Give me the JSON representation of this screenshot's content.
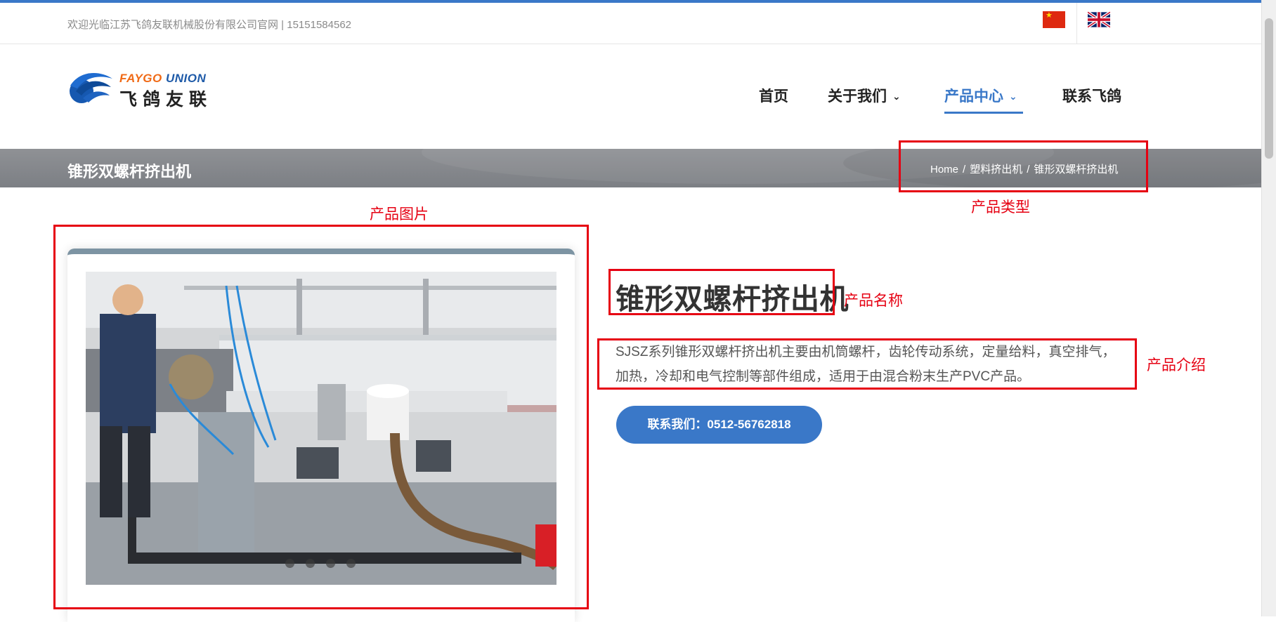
{
  "topbar": {
    "welcome_text": "欢迎光临江苏飞鸽友联机械股份有限公司官网 | 15151584562"
  },
  "logo": {
    "text_en_1": "FAYGO",
    "text_en_2": "UNION",
    "text_cn": "飞鸽友联"
  },
  "nav": {
    "items": [
      {
        "label": "首页"
      },
      {
        "label": "关于我们",
        "dropdown_icon": "chevron-down-icon"
      },
      {
        "label": "产品中心",
        "dropdown_icon": "chevron-down-icon",
        "active": true
      },
      {
        "label": "联系飞鸽"
      }
    ],
    "active_color": "#3a78c8"
  },
  "banner": {
    "title": "锥形双螺杆挤出机",
    "breadcrumb": [
      "Home",
      "塑料挤出机",
      "锥形双螺杆挤出机"
    ]
  },
  "product": {
    "name": "锥形双螺杆挤出机",
    "description": "SJSZ系列锥形双螺杆挤出机主要由机筒螺杆，齿轮传动系统，定量给料，真空排气，加热，冷却和电气控制等部件组成，适用于由混合粉末生产PVC产品。",
    "contact_button": "联系我们：0512-56762818"
  },
  "annotations": {
    "product_image": "产品图片",
    "product_type": "产品类型",
    "product_name": "产品名称",
    "product_intro": "产品介绍",
    "color": "#e60012"
  }
}
